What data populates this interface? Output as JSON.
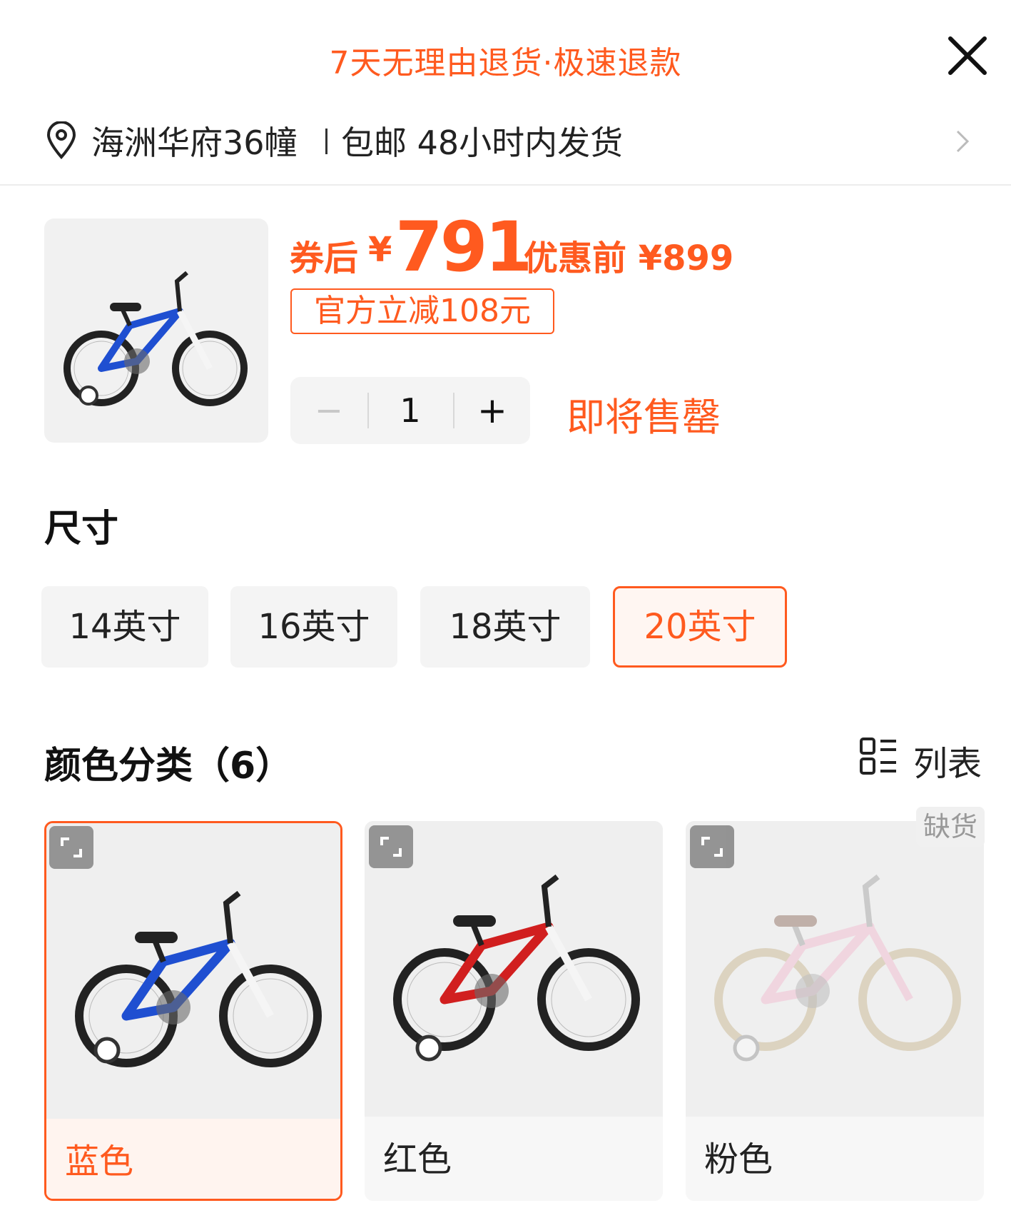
{
  "banner": {
    "text": "7天无理由退货·极速退款"
  },
  "delivery": {
    "address": "海洲华府36幢",
    "shipping": "包邮 48小时内发货"
  },
  "product": {
    "coupon_label": "券后",
    "currency": "¥",
    "coupon_price": "791",
    "original_price": "优惠前 ¥899",
    "discount_tag": "官方立减108元",
    "image": "blue-kids-bike"
  },
  "quantity": {
    "minus": "−",
    "value": "1",
    "plus": "+"
  },
  "stock_status": "即将售罄",
  "size": {
    "title": "尺寸",
    "options": [
      "14英寸",
      "16英寸",
      "18英寸",
      "20英寸"
    ],
    "selected": "20英寸"
  },
  "color": {
    "title": "颜色分类（6）",
    "view_toggle": "列表",
    "items": [
      {
        "label": "蓝色",
        "image": "blue-kids-bike",
        "selected": true,
        "out_of_stock": false
      },
      {
        "label": "红色",
        "image": "red-kids-bike",
        "selected": false,
        "out_of_stock": false
      },
      {
        "label": "粉色",
        "image": "pink-kids-bike",
        "selected": false,
        "out_of_stock": true,
        "badge": "缺货"
      }
    ]
  },
  "colors": {
    "accent": "#ff5a1f",
    "blue_frame": "#1f4fd1",
    "red_frame": "#d11f1f",
    "pink_frame": "#f2a6c4"
  }
}
